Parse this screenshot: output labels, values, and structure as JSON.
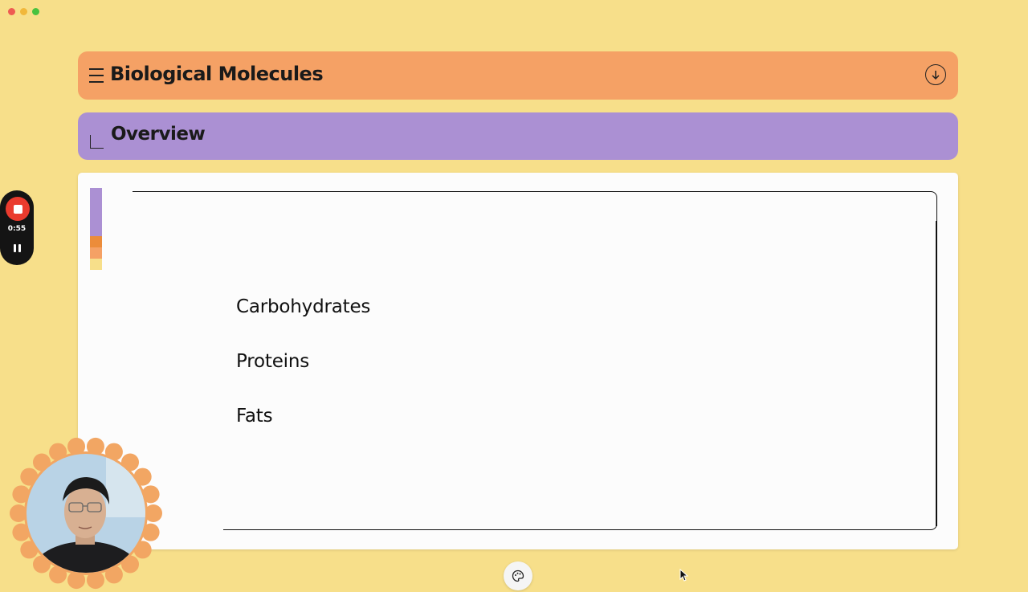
{
  "header": {
    "title": "Biological Molecules",
    "menu_icon": "hamburger-icon",
    "download_icon": "arrow-down-circle-icon"
  },
  "section": {
    "title": "Overview",
    "icon": "corner-bracket-icon"
  },
  "content": {
    "topics": [
      "Carbohydrates",
      "Proteins",
      "Fats"
    ]
  },
  "recorder": {
    "time": "0:55",
    "stop_icon": "stop-icon",
    "pause_icon": "pause-icon"
  },
  "toolbar": {
    "palette_icon": "palette-icon"
  },
  "colors": {
    "background": "#f7df8a",
    "header": "#f5a165",
    "section": "#ab90d3",
    "accent_orange": "#ec8c3a",
    "record": "#ea3b2e"
  }
}
